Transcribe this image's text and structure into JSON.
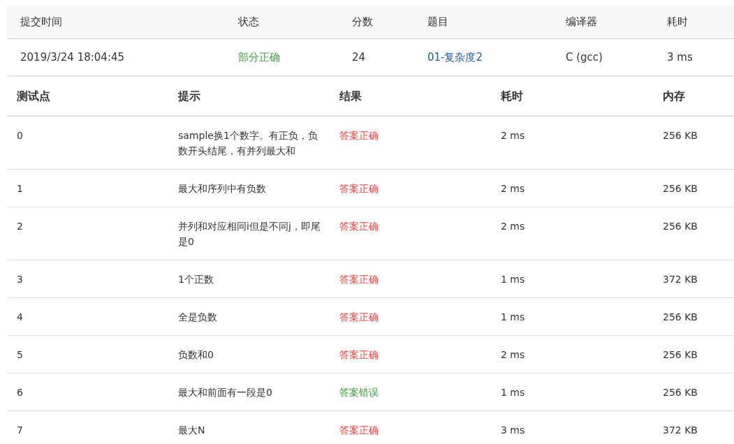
{
  "submission": {
    "columns": [
      "提交时间",
      "状态",
      "分数",
      "题目",
      "编译器",
      "耗时"
    ],
    "row": {
      "time": "2019/3/24 18:04:45",
      "status": "部分正确",
      "score": "24",
      "problem": "01-复杂度2",
      "compiler": "C (gcc)",
      "duration": "3 ms"
    }
  },
  "cases": {
    "columns": [
      "测试点",
      "提示",
      "结果",
      "耗时",
      "内存"
    ],
    "rows": [
      {
        "id": "0",
        "hint": "sample换1个数字。有正负，负数开头结尾，有并列最大和",
        "result": "答案正确",
        "color": "#f2453d",
        "time": "2 ms",
        "memory": "256 KB"
      },
      {
        "id": "1",
        "hint": "最大和序列中有负数",
        "result": "答案正确",
        "color": "#f2453d",
        "time": "2 ms",
        "memory": "256 KB"
      },
      {
        "id": "2",
        "hint": "并列和对应相同i但是不同j，即尾是0",
        "result": "答案正确",
        "color": "#f2453d",
        "time": "2 ms",
        "memory": "256 KB"
      },
      {
        "id": "3",
        "hint": "1个正数",
        "result": "答案正确",
        "color": "#f2453d",
        "time": "1 ms",
        "memory": "372 KB"
      },
      {
        "id": "4",
        "hint": "全是负数",
        "result": "答案正确",
        "color": "#f2453d",
        "time": "1 ms",
        "memory": "256 KB"
      },
      {
        "id": "5",
        "hint": "负数和0",
        "result": "答案正确",
        "color": "#f2453d",
        "time": "2 ms",
        "memory": "256 KB"
      },
      {
        "id": "6",
        "hint": "最大和前面有一段是0",
        "result": "答案错误",
        "color": "#3da13d",
        "time": "1 ms",
        "memory": "256 KB"
      },
      {
        "id": "7",
        "hint": "最大N",
        "result": "答案正确",
        "color": "#f2453d",
        "time": "3 ms",
        "memory": "372 KB"
      }
    ]
  }
}
